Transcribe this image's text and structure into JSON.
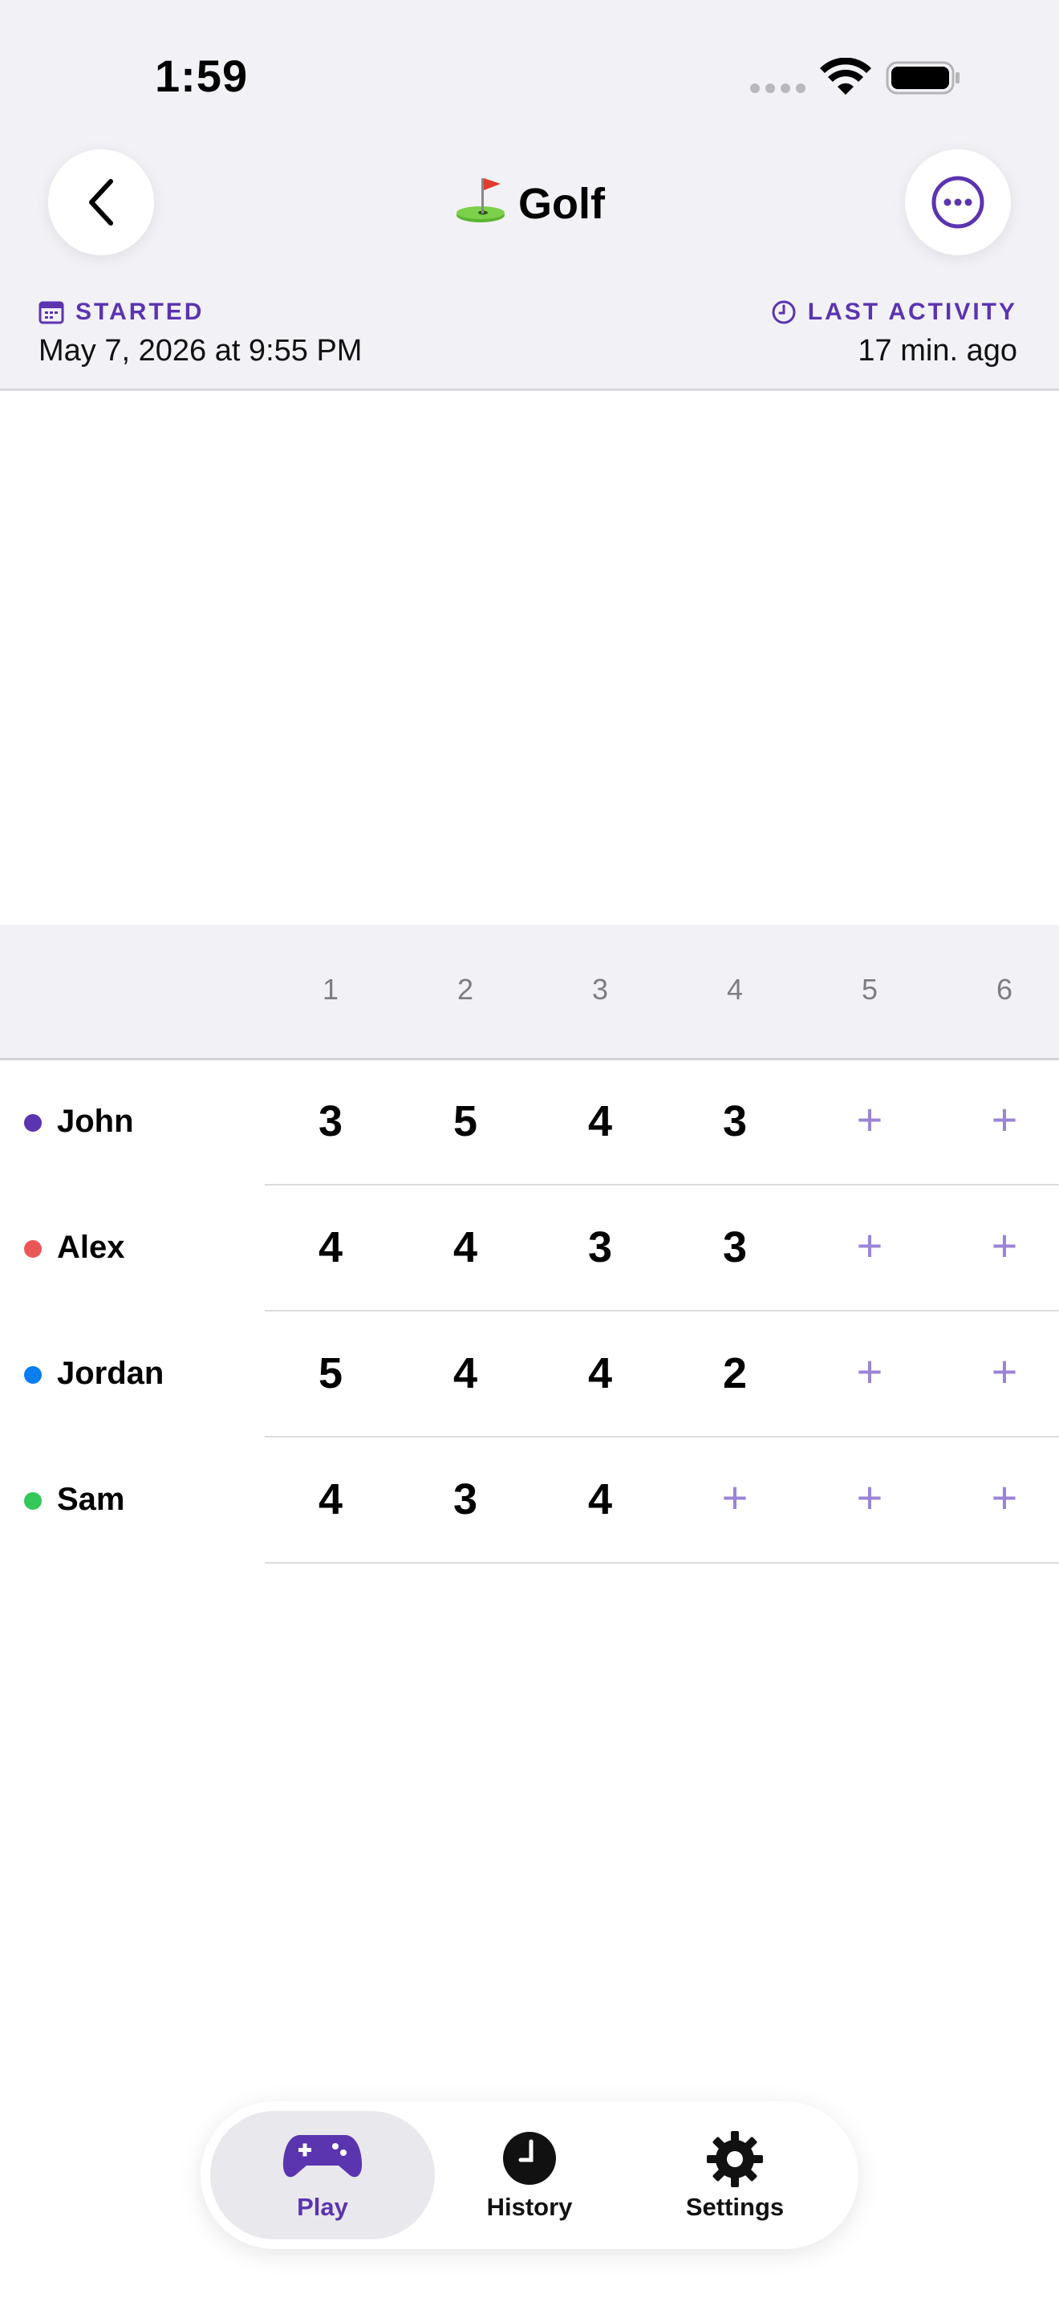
{
  "status_bar": {
    "time": "1:59"
  },
  "header": {
    "title": "Golf",
    "title_icon": "golf-flag-emoji",
    "back_icon": "chevron-left-icon",
    "more_icon": "ellipsis-circle-icon"
  },
  "meta": {
    "started_label": "STARTED",
    "started_value": "May 7, 2026 at 9:55 PM",
    "last_activity_label": "LAST ACTIVITY",
    "last_activity_value": "17 min. ago"
  },
  "scoreboard": {
    "holes": [
      "1",
      "2",
      "3",
      "4",
      "5",
      "6"
    ],
    "add_symbol": "+",
    "players": [
      {
        "name": "John",
        "color": "#5b34b0",
        "scores": [
          "3",
          "5",
          "4",
          "3",
          null,
          null
        ]
      },
      {
        "name": "Alex",
        "color": "#eb5757",
        "scores": [
          "4",
          "4",
          "3",
          "3",
          null,
          null
        ]
      },
      {
        "name": "Jordan",
        "color": "#0a7df0",
        "scores": [
          "5",
          "4",
          "4",
          "2",
          null,
          null
        ]
      },
      {
        "name": "Sam",
        "color": "#34c759",
        "scores": [
          "4",
          "3",
          "4",
          null,
          null,
          null
        ]
      }
    ]
  },
  "tab_bar": {
    "tabs": [
      {
        "label": "Play",
        "icon": "gamecontroller-icon",
        "active": true
      },
      {
        "label": "History",
        "icon": "clock-icon",
        "active": false
      },
      {
        "label": "Settings",
        "icon": "gear-icon",
        "active": false
      }
    ]
  },
  "colors": {
    "accent": "#5b34b0",
    "add_button": "#9b84d6"
  }
}
